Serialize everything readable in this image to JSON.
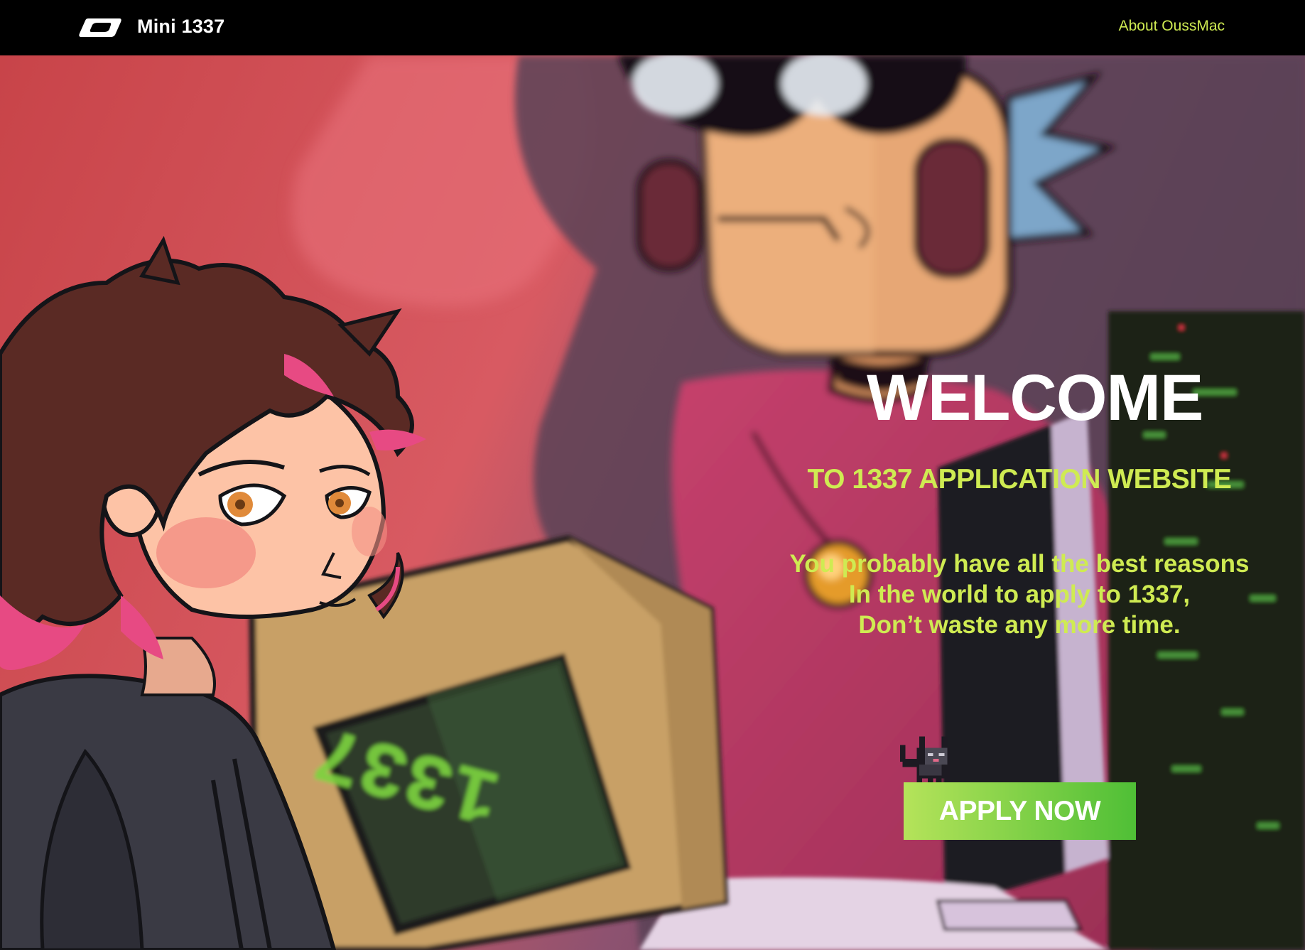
{
  "nav": {
    "logo_icon": "stylized-loop-logo-icon",
    "brand": "Mini 1337",
    "about_link": "About OussMac"
  },
  "hero": {
    "heading": "WELCOME",
    "subheading": "TO 1337 APPLICATION WEBSITE",
    "tagline": [
      "You probably have all the best reasons",
      "In the world to apply to 1337,",
      "Don’t waste any more time."
    ],
    "monitor_screen_text": "1337",
    "mascot_icon": "pixel-cat-icon",
    "cta_label": "APPLY NOW"
  },
  "colors": {
    "accent_green": "#cfeb52",
    "nav_background": "#000000",
    "button_gradient_start": "#b5e35a",
    "button_gradient_end": "#4fbf36",
    "heading_white": "#ffffff"
  }
}
